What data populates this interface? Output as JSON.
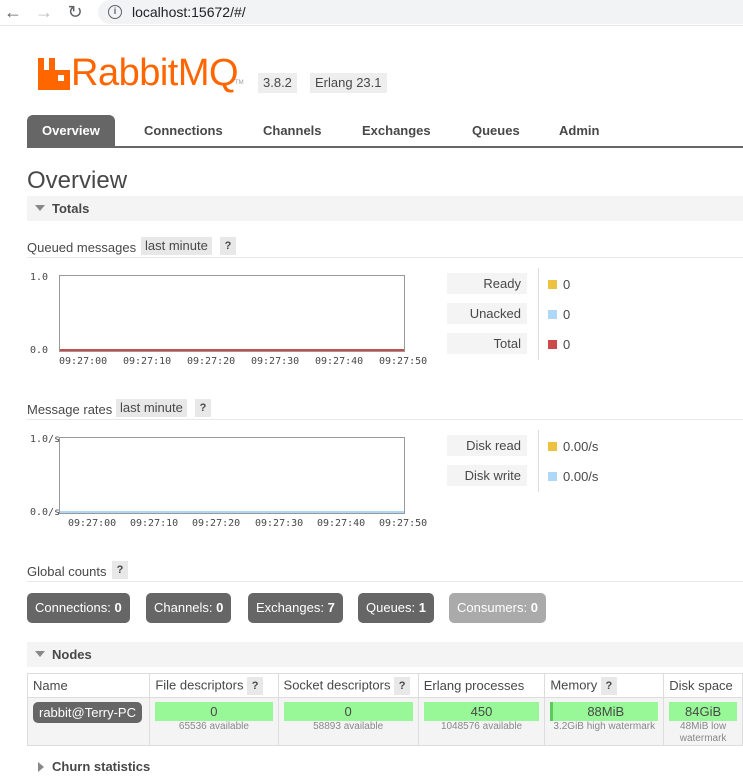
{
  "browser": {
    "url": "localhost:15672/#/"
  },
  "header": {
    "logo_text": "RabbitMQ",
    "logo_tm": "TM",
    "version": "3.8.2",
    "erlang": "Erlang 23.1"
  },
  "tabs": [
    {
      "label": "Overview",
      "active": true
    },
    {
      "label": "Connections"
    },
    {
      "label": "Channels"
    },
    {
      "label": "Exchanges"
    },
    {
      "label": "Queues"
    },
    {
      "label": "Admin"
    }
  ],
  "page_title": "Overview",
  "totals": {
    "label": "Totals"
  },
  "queued": {
    "title": "Queued messages",
    "range": "last minute",
    "help": "?",
    "y_max": "1.0",
    "y_min": "0.0",
    "ticks": [
      "09:27:00",
      "09:27:10",
      "09:27:20",
      "09:27:30",
      "09:27:40",
      "09:27:50"
    ],
    "legend": [
      {
        "label": "Ready",
        "value": "0",
        "color": "#edc240"
      },
      {
        "label": "Unacked",
        "value": "0",
        "color": "#afd8f8"
      },
      {
        "label": "Total",
        "value": "0",
        "color": "#cb4b4b"
      }
    ]
  },
  "rates": {
    "title": "Message rates",
    "range": "last minute",
    "help": "?",
    "y_max": "1.0/s",
    "y_min": "0.0/s",
    "ticks": [
      "09:27:00",
      "09:27:10",
      "09:27:20",
      "09:27:30",
      "09:27:40",
      "09:27:50"
    ],
    "legend": [
      {
        "label": "Disk read",
        "value": "0.00/s",
        "color": "#edc240"
      },
      {
        "label": "Disk write",
        "value": "0.00/s",
        "color": "#afd8f8"
      }
    ]
  },
  "global_counts": {
    "title": "Global counts",
    "help": "?",
    "items": [
      {
        "label": "Connections:",
        "value": "0"
      },
      {
        "label": "Channels:",
        "value": "0"
      },
      {
        "label": "Exchanges:",
        "value": "7"
      },
      {
        "label": "Queues:",
        "value": "1"
      },
      {
        "label": "Consumers:",
        "value": "0"
      }
    ]
  },
  "nodes": {
    "label": "Nodes",
    "headers": [
      "Name",
      "File descriptors",
      "Socket descriptors",
      "Erlang processes",
      "Memory",
      "Disk space"
    ],
    "help": "?",
    "row": {
      "name": "rabbit@Terry-PC",
      "fd": "0",
      "fd_sub": "65536 available",
      "sockets": "0",
      "sockets_sub": "58893 available",
      "procs": "450",
      "procs_sub": "1048576 available",
      "memory": "88MiB",
      "memory_sub": "3.2GiB high watermark",
      "disk": "84GiB",
      "disk_sub": "48MiB low watermark"
    }
  },
  "churn": {
    "label": "Churn statistics"
  }
}
